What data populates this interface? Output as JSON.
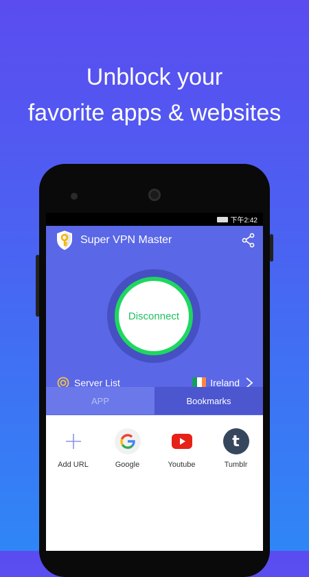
{
  "headline": {
    "line1": "Unblock your",
    "line2": "favorite apps & websites"
  },
  "statusbar": {
    "time": "下午2:42"
  },
  "app": {
    "title": "Super VPN Master",
    "button": "Disconnect",
    "accent": "#5a67e6",
    "connected_color": "#1ed760"
  },
  "server": {
    "label": "Server List",
    "country": "Ireland"
  },
  "tabs": [
    {
      "label": "APP",
      "active": false
    },
    {
      "label": "Bookmarks",
      "active": true
    }
  ],
  "bookmarks": [
    {
      "label": "Add URL",
      "icon": "plus-icon"
    },
    {
      "label": "Google",
      "icon": "google-icon"
    },
    {
      "label": "Youtube",
      "icon": "youtube-icon"
    },
    {
      "label": "Tumblr",
      "icon": "tumblr-icon"
    }
  ]
}
